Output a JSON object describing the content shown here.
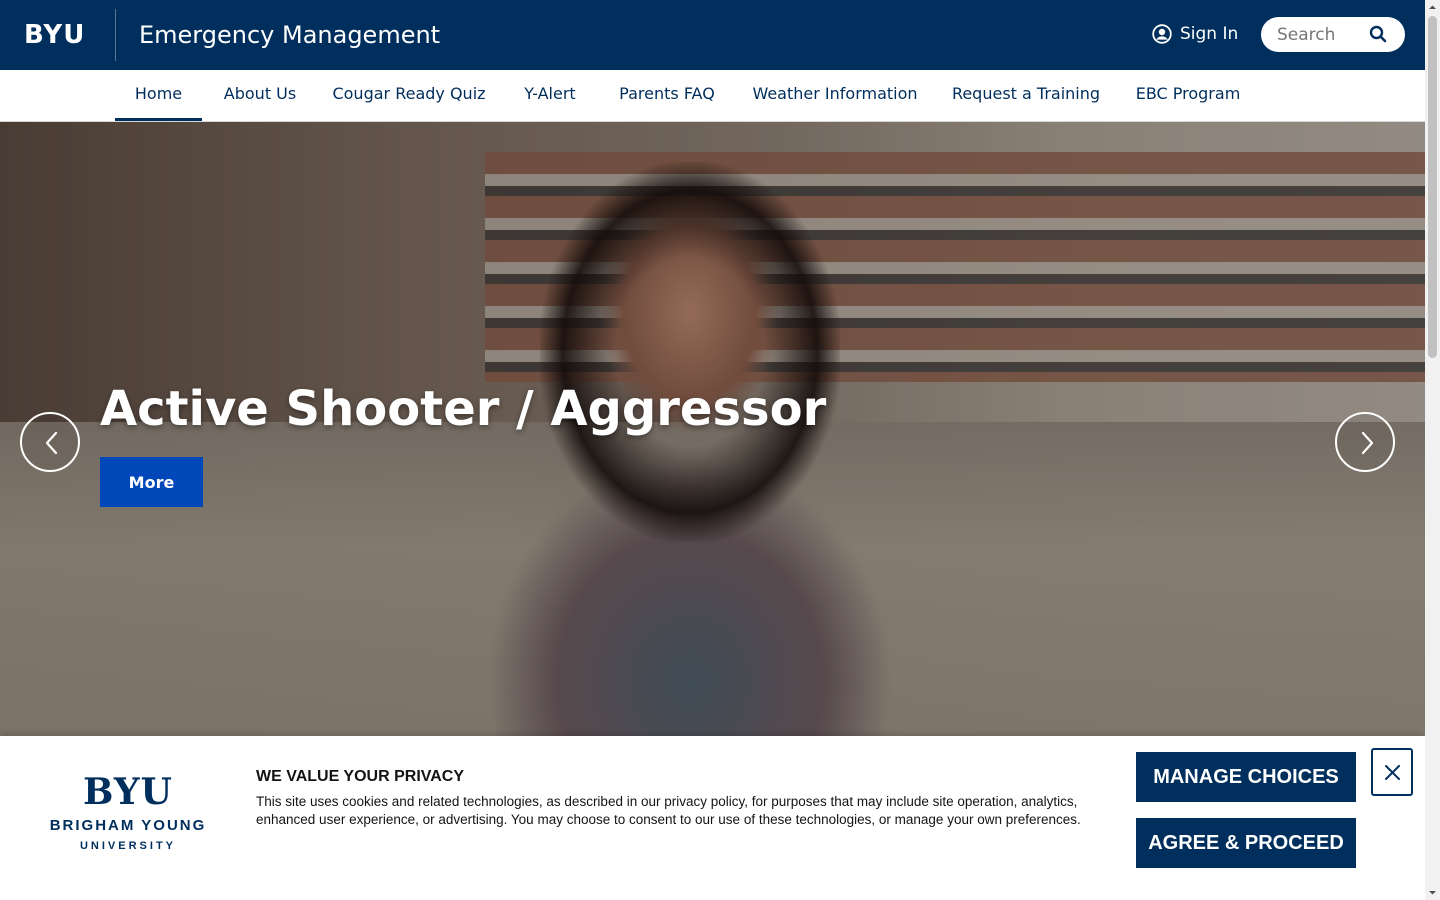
{
  "header": {
    "logo_text": "BYU",
    "site_title": "Emergency Management",
    "signin_label": "Sign In",
    "search_placeholder": "Search",
    "search_value": ""
  },
  "nav": {
    "items": [
      {
        "label": "Home",
        "active": true
      },
      {
        "label": "About Us"
      },
      {
        "label": "Cougar Ready Quiz"
      },
      {
        "label": "Y-Alert"
      },
      {
        "label": "Parents FAQ"
      },
      {
        "label": "Weather Information"
      },
      {
        "label": "Request a Training"
      },
      {
        "label": "EBC Program"
      }
    ]
  },
  "hero": {
    "title": "Active Shooter / Aggressor",
    "button_label": "More"
  },
  "cookie_banner": {
    "logo_main": "BYU",
    "logo_line1": "BRIGHAM YOUNG",
    "logo_line2": "UNIVERSITY",
    "heading": "WE VALUE YOUR PRIVACY",
    "body": "This site uses cookies and related technologies, as described in our privacy policy, for purposes that may include site operation, analytics, enhanced user experience, or advertising. You may choose to consent to our use of these technologies, or manage your own preferences.",
    "manage_label": "MANAGE CHOICES",
    "agree_label": "AGREE & PROCEED"
  },
  "colors": {
    "brand_navy": "#002E5D",
    "button_blue": "#0047BA"
  }
}
